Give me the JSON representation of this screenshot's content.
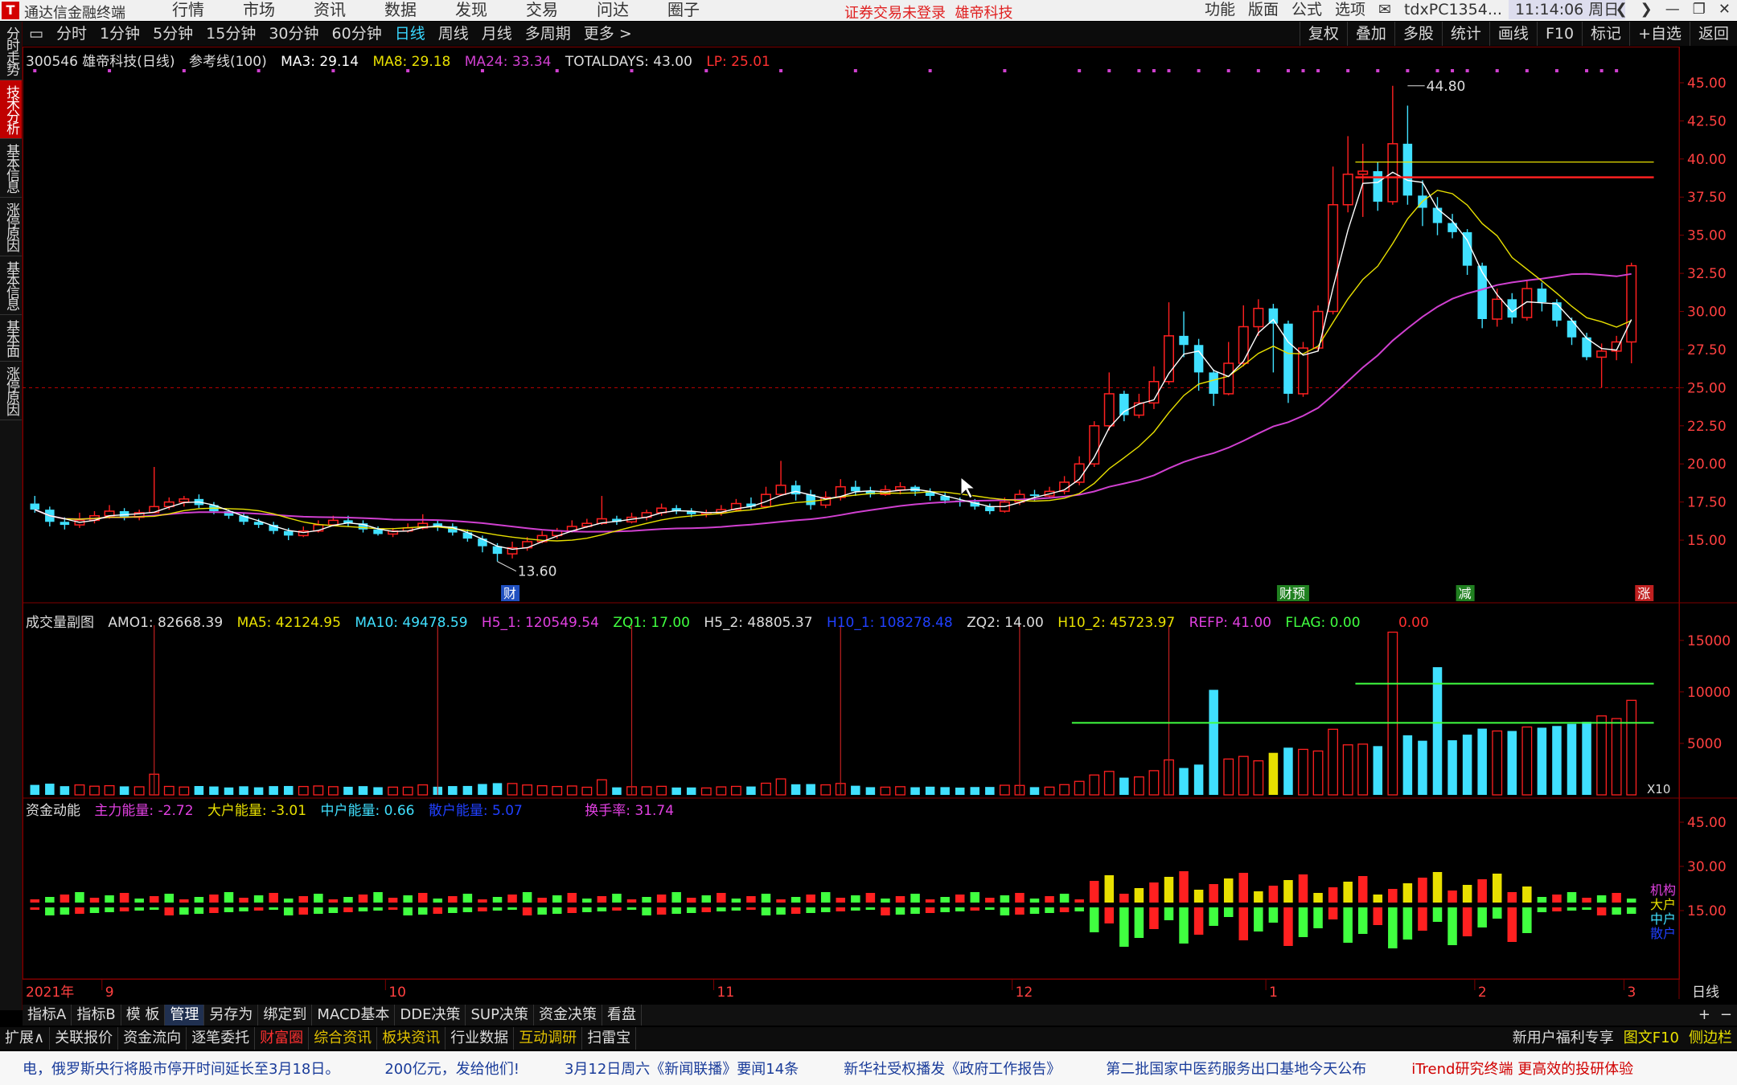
{
  "menubar": {
    "app_name": "通达信金融终端",
    "menus": [
      "行情",
      "市场",
      "资讯",
      "数据",
      "发现",
      "交易",
      "问达",
      "圈子"
    ],
    "notice": "证券交易未登录",
    "notice_stock": "雄帝科技",
    "right_items": [
      "功能",
      "版面",
      "公式",
      "选项"
    ],
    "host": "tdxPC1354...",
    "clock": "11:14:06 周日"
  },
  "toolbar": {
    "periods": [
      "分时",
      "1分钟",
      "5分钟",
      "15分钟",
      "30分钟",
      "60分钟",
      "日线",
      "周线",
      "月线",
      "多周期",
      "更多 >"
    ],
    "active_period": "日线",
    "tools": [
      "复权",
      "叠加",
      "多股",
      "统计",
      "画线",
      "F10",
      "标记",
      "+自选",
      "返回"
    ]
  },
  "left_tabs": [
    "分时走势",
    "技术分析",
    "基本信息",
    "涨停原因",
    "基本信息",
    "基本面",
    "涨停原因"
  ],
  "main_legend": {
    "stock": "300546 雄帝科技(日线)",
    "indicator": "参考线(100)",
    "ma3": "MA3: 29.14",
    "ma8": "MA8: 29.18",
    "ma24": "MA24: 33.34",
    "totaldays": "TOTALDAYS: 43.00",
    "lp": "LP: 25.01"
  },
  "vol_legend": {
    "name": "成交量副图",
    "amo1": "AMO1: 82668.39",
    "ma5": "MA5: 42124.95",
    "ma10": "MA10: 49478.59",
    "h5_1": "H5_1: 120549.54",
    "zq1": "ZQ1: 17.00",
    "h5_2": "H5_2: 48805.37",
    "h10_1": "H10_1: 108278.48",
    "zq2": "ZQ2: 14.00",
    "h10_2": "H10_2: 45723.97",
    "refp": "REFP: 41.00",
    "flag": "FLAG: 0.00",
    "extra": "0.00"
  },
  "fund_legend": {
    "name": "资金动能",
    "main": "主力能量: -2.72",
    "big": "大户能量: -3.01",
    "mid": "中户能量: 0.66",
    "retail": "散户能量: 5.07",
    "turnover": "换手率: 31.74"
  },
  "fund_labels": [
    "机构",
    "大户",
    "中户",
    "散户"
  ],
  "markers": {
    "cai": "财",
    "yuyu": "财预",
    "jian": "减",
    "zhang": "涨"
  },
  "annotations": {
    "high": "44.80",
    "low": "13.60"
  },
  "vol_x10": "X10",
  "x_axis": {
    "year": "2021年",
    "months": [
      "9",
      "10",
      "11",
      "12",
      "1",
      "2",
      "3"
    ],
    "period_label": "日线"
  },
  "price_axis": [
    "45.00",
    "42.50",
    "40.00",
    "37.50",
    "35.00",
    "32.50",
    "30.00",
    "27.50",
    "25.00",
    "22.50",
    "20.00",
    "17.50",
    "15.00"
  ],
  "vol_axis": [
    "15000",
    "10000",
    "5000"
  ],
  "fund_axis": [
    "45.00",
    "30.00",
    "15.00"
  ],
  "idx_tabs": [
    "指标A",
    "指标B",
    "模 板",
    "管理",
    "另存为",
    "绑定到",
    "MACD基本",
    "DDE决策",
    "SUP决策",
    "资金决策",
    "看盘"
  ],
  "idx_active": "管理",
  "idx_right": [
    "+",
    "−"
  ],
  "func_tabs": [
    "扩展∧",
    "关联报价",
    "资金流向",
    "逐笔委托",
    "财富圈",
    "综合资讯",
    "板块资讯",
    "行业数据",
    "互动调研",
    "扫雷宝"
  ],
  "func_right": [
    "新用户福利专享",
    "图文F10",
    "侧边栏"
  ],
  "ticker": [
    "电，俄罗斯央行将股市停开时间延长至3月18日。",
    "200亿元，发给他们!",
    "3月12日周六《新闻联播》要闻14条",
    "新华社受权播发《政府工作报告》",
    "第二批国家中医药服务出口基地今天公布",
    "iTrend研究终端 更高效的投研体验"
  ],
  "colors": {
    "up": "#ff2020",
    "down": "#40e0ff",
    "ma3": "#ffffff",
    "ma8": "#e8e000",
    "ma24": "#d040d0",
    "refline": "#ff2020",
    "dashed": "#c00000"
  },
  "chart_data": {
    "type": "candlestick",
    "ylim": [
      13.0,
      46.0
    ],
    "candles": [
      [
        17.4,
        17.0,
        17.9,
        16.8
      ],
      [
        17.0,
        16.2,
        17.2,
        15.9
      ],
      [
        16.2,
        16.0,
        16.5,
        15.7
      ],
      [
        16.0,
        16.3,
        16.8,
        15.8
      ],
      [
        16.3,
        16.6,
        16.9,
        16.1
      ],
      [
        16.6,
        16.9,
        17.3,
        16.4
      ],
      [
        16.9,
        16.5,
        17.1,
        16.3
      ],
      [
        16.5,
        16.8,
        17.0,
        16.3
      ],
      [
        16.8,
        17.2,
        19.8,
        16.8
      ],
      [
        17.2,
        17.5,
        17.8,
        17.0
      ],
      [
        17.5,
        17.7,
        17.9,
        17.2
      ],
      [
        17.7,
        17.3,
        18.0,
        17.1
      ],
      [
        17.3,
        16.9,
        17.5,
        16.7
      ],
      [
        16.9,
        16.6,
        17.0,
        16.4
      ],
      [
        16.6,
        16.2,
        16.8,
        16.0
      ],
      [
        16.2,
        16.0,
        16.4,
        15.8
      ],
      [
        16.0,
        15.6,
        16.2,
        15.4
      ],
      [
        15.6,
        15.3,
        15.8,
        15.0
      ],
      [
        15.3,
        15.6,
        15.9,
        15.2
      ],
      [
        15.6,
        16.0,
        16.3,
        15.5
      ],
      [
        16.0,
        16.3,
        16.6,
        15.9
      ],
      [
        16.3,
        16.1,
        16.6,
        15.9
      ],
      [
        16.1,
        15.7,
        16.3,
        15.5
      ],
      [
        15.7,
        15.4,
        15.9,
        15.3
      ],
      [
        15.4,
        15.6,
        15.8,
        15.2
      ],
      [
        15.6,
        15.8,
        16.1,
        15.5
      ],
      [
        15.8,
        16.1,
        16.7,
        15.7
      ],
      [
        16.1,
        15.9,
        16.3,
        15.6
      ],
      [
        15.9,
        15.5,
        16.1,
        15.3
      ],
      [
        15.5,
        15.1,
        15.7,
        14.9
      ],
      [
        15.1,
        14.6,
        15.3,
        14.2
      ],
      [
        14.6,
        14.1,
        14.8,
        13.6
      ],
      [
        14.1,
        14.5,
        14.9,
        13.8
      ],
      [
        14.5,
        14.9,
        15.2,
        14.3
      ],
      [
        14.9,
        15.3,
        15.6,
        14.8
      ],
      [
        15.3,
        15.6,
        15.8,
        15.1
      ],
      [
        15.6,
        15.9,
        16.3,
        15.5
      ],
      [
        15.9,
        16.1,
        16.4,
        15.8
      ],
      [
        16.1,
        16.4,
        17.9,
        16.0
      ],
      [
        16.4,
        16.2,
        16.6,
        16.0
      ],
      [
        16.2,
        16.5,
        16.8,
        16.1
      ],
      [
        16.5,
        16.8,
        17.0,
        16.3
      ],
      [
        16.8,
        17.1,
        17.4,
        16.6
      ],
      [
        17.1,
        16.9,
        17.3,
        16.7
      ],
      [
        16.9,
        16.7,
        17.1,
        16.5
      ],
      [
        16.7,
        16.8,
        17.0,
        16.5
      ],
      [
        16.8,
        17.0,
        17.3,
        16.6
      ],
      [
        17.0,
        17.4,
        17.7,
        16.9
      ],
      [
        17.4,
        17.2,
        17.8,
        17.0
      ],
      [
        17.2,
        18.0,
        18.5,
        17.1
      ],
      [
        18.0,
        18.6,
        20.2,
        17.9
      ],
      [
        18.6,
        18.0,
        18.9,
        17.6
      ],
      [
        18.0,
        17.3,
        18.3,
        17.0
      ],
      [
        17.3,
        17.8,
        18.2,
        17.1
      ],
      [
        17.8,
        18.5,
        19.0,
        17.6
      ],
      [
        18.5,
        18.2,
        18.9,
        17.9
      ],
      [
        18.2,
        18.0,
        18.5,
        17.8
      ],
      [
        18.0,
        18.3,
        18.6,
        17.9
      ],
      [
        18.3,
        18.5,
        18.8,
        18.0
      ],
      [
        18.5,
        18.2,
        18.6,
        17.9
      ],
      [
        18.2,
        17.9,
        18.4,
        17.6
      ],
      [
        17.9,
        17.6,
        18.1,
        17.4
      ],
      [
        17.6,
        17.5,
        17.8,
        17.2
      ],
      [
        17.5,
        17.2,
        17.7,
        17.0
      ],
      [
        17.2,
        16.9,
        17.4,
        16.7
      ],
      [
        16.9,
        17.5,
        17.8,
        16.8
      ],
      [
        17.5,
        18.0,
        18.3,
        17.3
      ],
      [
        18.0,
        17.9,
        18.3,
        17.6
      ],
      [
        17.9,
        18.2,
        18.5,
        17.8
      ],
      [
        18.2,
        18.8,
        19.2,
        18.0
      ],
      [
        18.8,
        20.0,
        20.5,
        18.6
      ],
      [
        20.0,
        22.5,
        22.8,
        19.8
      ],
      [
        22.5,
        24.6,
        26.0,
        22.2
      ],
      [
        24.6,
        23.2,
        24.8,
        22.8
      ],
      [
        23.2,
        24.0,
        24.6,
        23.0
      ],
      [
        24.0,
        25.4,
        26.4,
        23.6
      ],
      [
        25.4,
        28.4,
        30.6,
        25.2
      ],
      [
        28.4,
        27.8,
        30.0,
        27.0
      ],
      [
        27.8,
        26.0,
        28.2,
        24.8
      ],
      [
        26.0,
        24.6,
        26.2,
        23.8
      ],
      [
        24.6,
        26.6,
        28.0,
        24.5
      ],
      [
        26.6,
        29.0,
        30.4,
        26.4
      ],
      [
        29.0,
        30.2,
        30.8,
        28.4
      ],
      [
        30.2,
        29.2,
        30.5,
        26.0
      ],
      [
        29.2,
        24.6,
        29.4,
        24.0
      ],
      [
        24.6,
        27.6,
        28.0,
        24.4
      ],
      [
        27.6,
        30.0,
        30.4,
        27.4
      ],
      [
        30.0,
        37.0,
        39.5,
        29.8
      ],
      [
        37.0,
        39.0,
        41.5,
        36.5
      ],
      [
        39.0,
        39.2,
        41.0,
        36.2
      ],
      [
        39.2,
        37.2,
        39.8,
        36.6
      ],
      [
        37.2,
        41.0,
        44.8,
        37.0
      ],
      [
        41.0,
        37.6,
        43.5,
        37.0
      ],
      [
        37.6,
        36.8,
        38.6,
        35.6
      ],
      [
        36.8,
        35.8,
        37.5,
        35.0
      ],
      [
        35.8,
        35.2,
        36.4,
        34.8
      ],
      [
        35.2,
        33.0,
        35.4,
        32.4
      ],
      [
        33.0,
        29.5,
        33.2,
        28.9
      ],
      [
        29.5,
        30.8,
        31.5,
        29.0
      ],
      [
        30.8,
        29.6,
        31.2,
        29.2
      ],
      [
        29.6,
        31.5,
        32.0,
        29.4
      ],
      [
        31.5,
        30.6,
        31.9,
        30.0
      ],
      [
        30.6,
        29.4,
        30.8,
        29.0
      ],
      [
        29.4,
        28.3,
        29.6,
        27.8
      ],
      [
        28.3,
        27.0,
        28.6,
        26.8
      ],
      [
        27.0,
        27.4,
        27.9,
        25.0
      ],
      [
        27.4,
        28.0,
        28.4,
        26.8
      ],
      [
        28.0,
        33.0,
        33.2,
        26.6
      ]
    ]
  }
}
